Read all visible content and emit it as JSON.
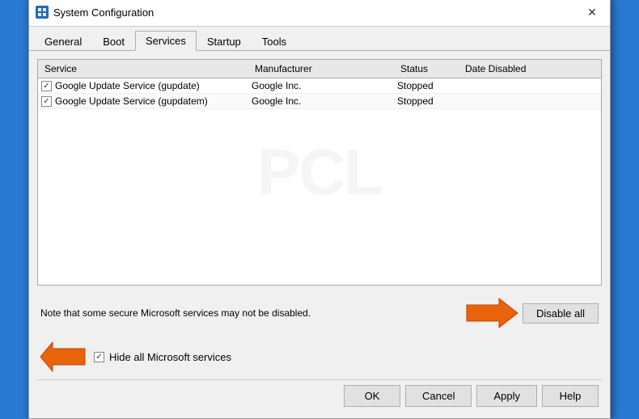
{
  "window": {
    "title": "System Configuration",
    "icon_label": "SC"
  },
  "tabs": [
    {
      "label": "General",
      "active": false
    },
    {
      "label": "Boot",
      "active": false
    },
    {
      "label": "Services",
      "active": true
    },
    {
      "label": "Startup",
      "active": false
    },
    {
      "label": "Tools",
      "active": false
    }
  ],
  "services_table": {
    "headers": [
      "Service",
      "Manufacturer",
      "Status",
      "Date Disabled"
    ],
    "rows": [
      {
        "checked": true,
        "name": "Google Update Service (gupdate)",
        "manufacturer": "Google Inc.",
        "status": "Stopped",
        "date_disabled": ""
      },
      {
        "checked": true,
        "name": "Google Update Service (gupdatem)",
        "manufacturer": "Google Inc.",
        "status": "Stopped",
        "date_disabled": ""
      }
    ]
  },
  "bottom_note": "Note that some secure Microsoft services may not be disabled.",
  "disable_all_label": "Disable all",
  "hide_ms_label": "Hide all Microsoft services",
  "buttons": {
    "ok": "OK",
    "cancel": "Cancel",
    "apply": "Apply",
    "help": "Help"
  },
  "watermark_text": "PCL"
}
